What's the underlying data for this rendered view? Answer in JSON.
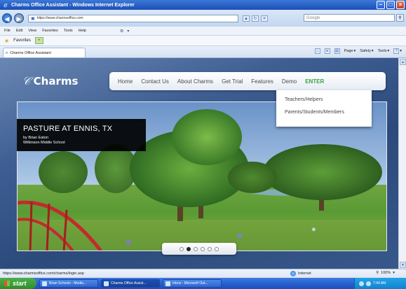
{
  "window": {
    "title": "Charms Office Assistant - Windows Internet Explorer",
    "controls": [
      "minimize",
      "maximize",
      "close"
    ]
  },
  "browser": {
    "address_url": "https://www.charmsoffice.com",
    "search_placeholder": "Google",
    "menu": [
      "File",
      "Edit",
      "View",
      "Favorites",
      "Tools",
      "Help"
    ],
    "favorites_label": "Favorites",
    "tab_title": "Charms Office Assistant",
    "command_bar": {
      "page_label": "Page",
      "safety_label": "Safety",
      "tools_label": "Tools"
    }
  },
  "site": {
    "logo_text": "Charms",
    "nav": [
      {
        "label": "Home"
      },
      {
        "label": "Contact Us"
      },
      {
        "label": "About Charms"
      },
      {
        "label": "Get Trial"
      },
      {
        "label": "Features"
      },
      {
        "label": "Demo"
      },
      {
        "label": "ENTER"
      }
    ],
    "enter_menu": [
      {
        "label": "Teachers/Helpers"
      },
      {
        "label": "Parents/Students/Members"
      }
    ],
    "slide": {
      "title": "PASTURE AT ENNIS, TX",
      "byline": "by Brian Eaton",
      "school": "Wilkinson Middle School"
    },
    "slider": {
      "dot_count": 6,
      "active_index": 1
    }
  },
  "status": {
    "url": "https://www.charmsoffice.com/charms/login.asp",
    "zone": "Internet",
    "zoom": "100%"
  },
  "taskbar": {
    "start_label": "start",
    "items": [
      {
        "label": "Brian Schools - Media..."
      },
      {
        "label": "Charms Office Assist..."
      },
      {
        "label": "Inbox - Microsoft Out..."
      }
    ],
    "clock": "7:44 AM"
  },
  "colors": {
    "accent_green": "#3aa043",
    "title_bar": "#1b4fb5",
    "page_bg": "#2c4a7c"
  }
}
